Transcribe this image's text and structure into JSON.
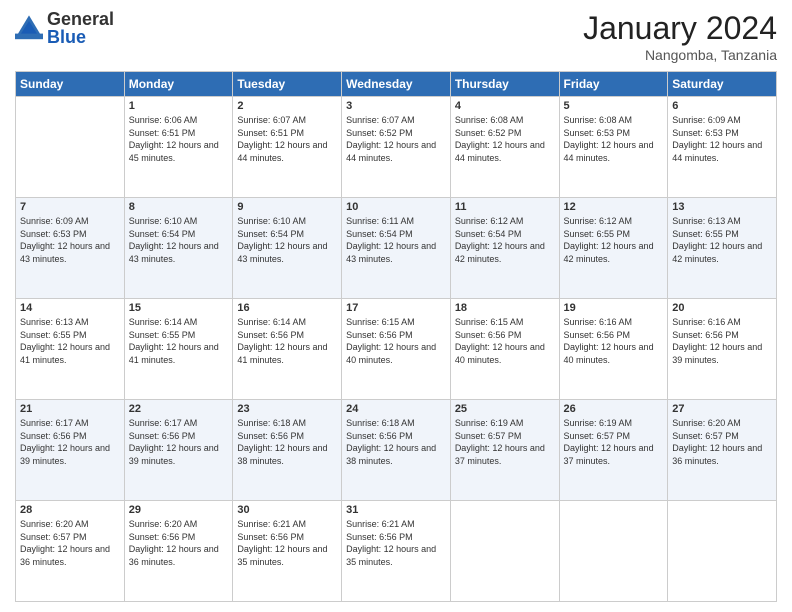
{
  "header": {
    "logo_general": "General",
    "logo_blue": "Blue",
    "month_title": "January 2024",
    "location": "Nangomba, Tanzania"
  },
  "weekdays": [
    "Sunday",
    "Monday",
    "Tuesday",
    "Wednesday",
    "Thursday",
    "Friday",
    "Saturday"
  ],
  "weeks": [
    [
      {
        "day": "",
        "sunrise": "",
        "sunset": "",
        "daylight": ""
      },
      {
        "day": "1",
        "sunrise": "6:06 AM",
        "sunset": "6:51 PM",
        "daylight": "12 hours and 45 minutes."
      },
      {
        "day": "2",
        "sunrise": "6:07 AM",
        "sunset": "6:51 PM",
        "daylight": "12 hours and 44 minutes."
      },
      {
        "day": "3",
        "sunrise": "6:07 AM",
        "sunset": "6:52 PM",
        "daylight": "12 hours and 44 minutes."
      },
      {
        "day": "4",
        "sunrise": "6:08 AM",
        "sunset": "6:52 PM",
        "daylight": "12 hours and 44 minutes."
      },
      {
        "day": "5",
        "sunrise": "6:08 AM",
        "sunset": "6:53 PM",
        "daylight": "12 hours and 44 minutes."
      },
      {
        "day": "6",
        "sunrise": "6:09 AM",
        "sunset": "6:53 PM",
        "daylight": "12 hours and 44 minutes."
      }
    ],
    [
      {
        "day": "7",
        "sunrise": "6:09 AM",
        "sunset": "6:53 PM",
        "daylight": "12 hours and 43 minutes."
      },
      {
        "day": "8",
        "sunrise": "6:10 AM",
        "sunset": "6:54 PM",
        "daylight": "12 hours and 43 minutes."
      },
      {
        "day": "9",
        "sunrise": "6:10 AM",
        "sunset": "6:54 PM",
        "daylight": "12 hours and 43 minutes."
      },
      {
        "day": "10",
        "sunrise": "6:11 AM",
        "sunset": "6:54 PM",
        "daylight": "12 hours and 43 minutes."
      },
      {
        "day": "11",
        "sunrise": "6:12 AM",
        "sunset": "6:54 PM",
        "daylight": "12 hours and 42 minutes."
      },
      {
        "day": "12",
        "sunrise": "6:12 AM",
        "sunset": "6:55 PM",
        "daylight": "12 hours and 42 minutes."
      },
      {
        "day": "13",
        "sunrise": "6:13 AM",
        "sunset": "6:55 PM",
        "daylight": "12 hours and 42 minutes."
      }
    ],
    [
      {
        "day": "14",
        "sunrise": "6:13 AM",
        "sunset": "6:55 PM",
        "daylight": "12 hours and 41 minutes."
      },
      {
        "day": "15",
        "sunrise": "6:14 AM",
        "sunset": "6:55 PM",
        "daylight": "12 hours and 41 minutes."
      },
      {
        "day": "16",
        "sunrise": "6:14 AM",
        "sunset": "6:56 PM",
        "daylight": "12 hours and 41 minutes."
      },
      {
        "day": "17",
        "sunrise": "6:15 AM",
        "sunset": "6:56 PM",
        "daylight": "12 hours and 40 minutes."
      },
      {
        "day": "18",
        "sunrise": "6:15 AM",
        "sunset": "6:56 PM",
        "daylight": "12 hours and 40 minutes."
      },
      {
        "day": "19",
        "sunrise": "6:16 AM",
        "sunset": "6:56 PM",
        "daylight": "12 hours and 40 minutes."
      },
      {
        "day": "20",
        "sunrise": "6:16 AM",
        "sunset": "6:56 PM",
        "daylight": "12 hours and 39 minutes."
      }
    ],
    [
      {
        "day": "21",
        "sunrise": "6:17 AM",
        "sunset": "6:56 PM",
        "daylight": "12 hours and 39 minutes."
      },
      {
        "day": "22",
        "sunrise": "6:17 AM",
        "sunset": "6:56 PM",
        "daylight": "12 hours and 39 minutes."
      },
      {
        "day": "23",
        "sunrise": "6:18 AM",
        "sunset": "6:56 PM",
        "daylight": "12 hours and 38 minutes."
      },
      {
        "day": "24",
        "sunrise": "6:18 AM",
        "sunset": "6:56 PM",
        "daylight": "12 hours and 38 minutes."
      },
      {
        "day": "25",
        "sunrise": "6:19 AM",
        "sunset": "6:57 PM",
        "daylight": "12 hours and 37 minutes."
      },
      {
        "day": "26",
        "sunrise": "6:19 AM",
        "sunset": "6:57 PM",
        "daylight": "12 hours and 37 minutes."
      },
      {
        "day": "27",
        "sunrise": "6:20 AM",
        "sunset": "6:57 PM",
        "daylight": "12 hours and 36 minutes."
      }
    ],
    [
      {
        "day": "28",
        "sunrise": "6:20 AM",
        "sunset": "6:57 PM",
        "daylight": "12 hours and 36 minutes."
      },
      {
        "day": "29",
        "sunrise": "6:20 AM",
        "sunset": "6:56 PM",
        "daylight": "12 hours and 36 minutes."
      },
      {
        "day": "30",
        "sunrise": "6:21 AM",
        "sunset": "6:56 PM",
        "daylight": "12 hours and 35 minutes."
      },
      {
        "day": "31",
        "sunrise": "6:21 AM",
        "sunset": "6:56 PM",
        "daylight": "12 hours and 35 minutes."
      },
      {
        "day": "",
        "sunrise": "",
        "sunset": "",
        "daylight": ""
      },
      {
        "day": "",
        "sunrise": "",
        "sunset": "",
        "daylight": ""
      },
      {
        "day": "",
        "sunrise": "",
        "sunset": "",
        "daylight": ""
      }
    ]
  ],
  "labels": {
    "sunrise_prefix": "Sunrise: ",
    "sunset_prefix": "Sunset: ",
    "daylight_prefix": "Daylight: "
  }
}
